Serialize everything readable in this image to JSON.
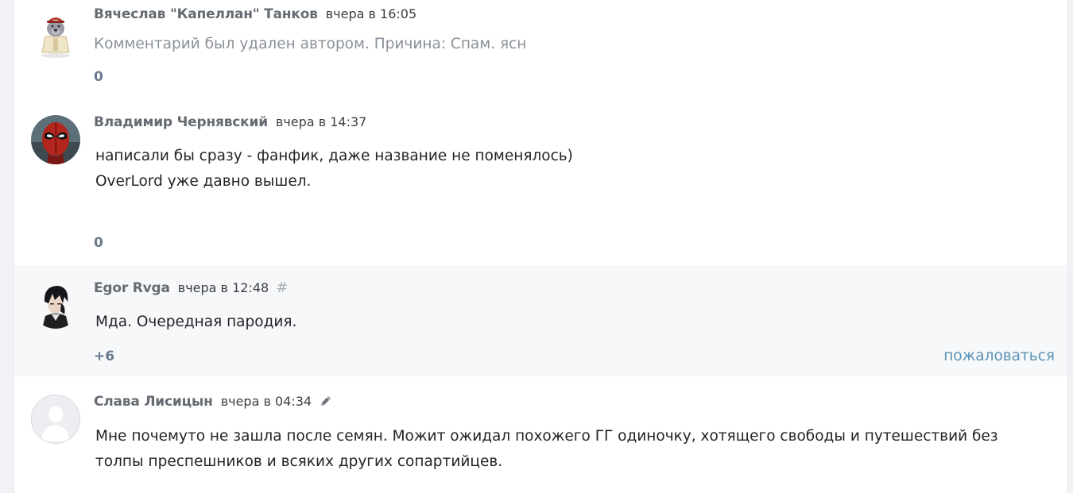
{
  "comments": [
    {
      "author": "Вячеслав \"Капеллан\" Танков",
      "date": "вчера в 16:05",
      "text_lines": [
        "Комментарий был удален автором. Причина: Спам. ясн"
      ],
      "rating": "0"
    },
    {
      "author": "Владимир Чернявский",
      "date": "вчера в 14:37",
      "text_lines": [
        "написали бы сразу - фанфик, даже название не поменялось)",
        "OverLord уже давно вышел."
      ],
      "rating": "0"
    },
    {
      "author": "Egor Rvga",
      "date": "вчера в 12:48",
      "hash": "#",
      "text_lines": [
        "Мда. Очередная пародия."
      ],
      "rating": "+6",
      "report": "пожаловаться"
    },
    {
      "author": "Слава Лисицын",
      "date": "вчера в 04:34",
      "text_lines": [
        "Мне почемуто не зашла после семян. Можит ожидал похожего ГГ одиночку, хотящего свободы и путешествий без",
        "толпы преспешников и всяких других сопартийцев."
      ]
    }
  ],
  "colors": {
    "author": "#656b72",
    "rating": "#6b7b8e",
    "report_link": "#5a93b5",
    "deleted_text": "#8a9097"
  }
}
